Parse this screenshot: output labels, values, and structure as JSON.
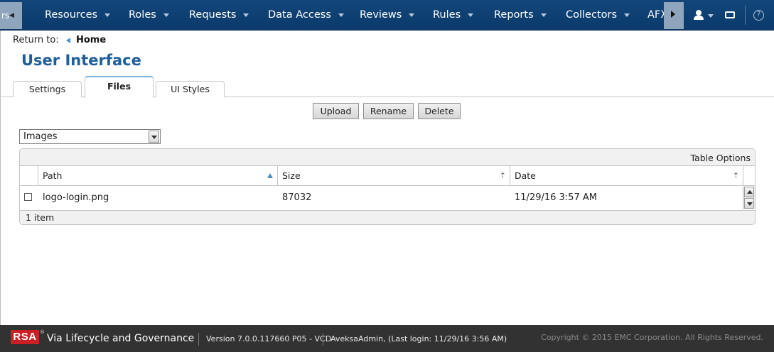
{
  "topnav": {
    "partial_item": "rs",
    "items": [
      {
        "label": "Resources"
      },
      {
        "label": "Roles"
      },
      {
        "label": "Requests"
      },
      {
        "label": "Data Access"
      },
      {
        "label": "Reviews"
      },
      {
        "label": "Rules"
      },
      {
        "label": "Reports"
      },
      {
        "label": "Collectors"
      },
      {
        "label": "AFX"
      }
    ],
    "icons": [
      "scroll-left-icon",
      "scroll-right-icon",
      "user-icon",
      "inbox-icon",
      "help-icon"
    ]
  },
  "breadcrumb": {
    "prefix": "Return to:",
    "link": "Home"
  },
  "page": {
    "title": "User Interface"
  },
  "tabs": [
    {
      "label": "Settings",
      "active": false
    },
    {
      "label": "Files",
      "active": true
    },
    {
      "label": "UI Styles",
      "active": false
    }
  ],
  "actions": {
    "upload": "Upload",
    "rename": "Rename",
    "delete": "Delete"
  },
  "filter": {
    "selected": "Images"
  },
  "table": {
    "options_label": "Table Options",
    "columns": [
      {
        "label": "Path",
        "sort": "ascending"
      },
      {
        "label": "Size",
        "sort": "none"
      },
      {
        "label": "Date",
        "sort": "none"
      }
    ],
    "rows": [
      {
        "path": "logo-login.png",
        "size": "87032",
        "date": "11/29/16 3:57 AM",
        "checked": false
      }
    ],
    "footer": "1 item"
  },
  "footer": {
    "logo": "RSA",
    "trademark": "®",
    "product": "Via Lifecycle and Governance",
    "version": "Version 7.0.0.117660 P05 - VCD",
    "login": "AveksaAdmin, (Last login: 11/29/16 3:56 AM)",
    "copyright": "Copyright © 2015 EMC Corporation. All Rights Reserved."
  },
  "colors": {
    "nav_bg": "#0b3a6b",
    "title": "#1f5f99",
    "footer_bg": "#323232",
    "logo_red": "#cc1f25",
    "active_tab_accent": "#7fb4e0"
  }
}
